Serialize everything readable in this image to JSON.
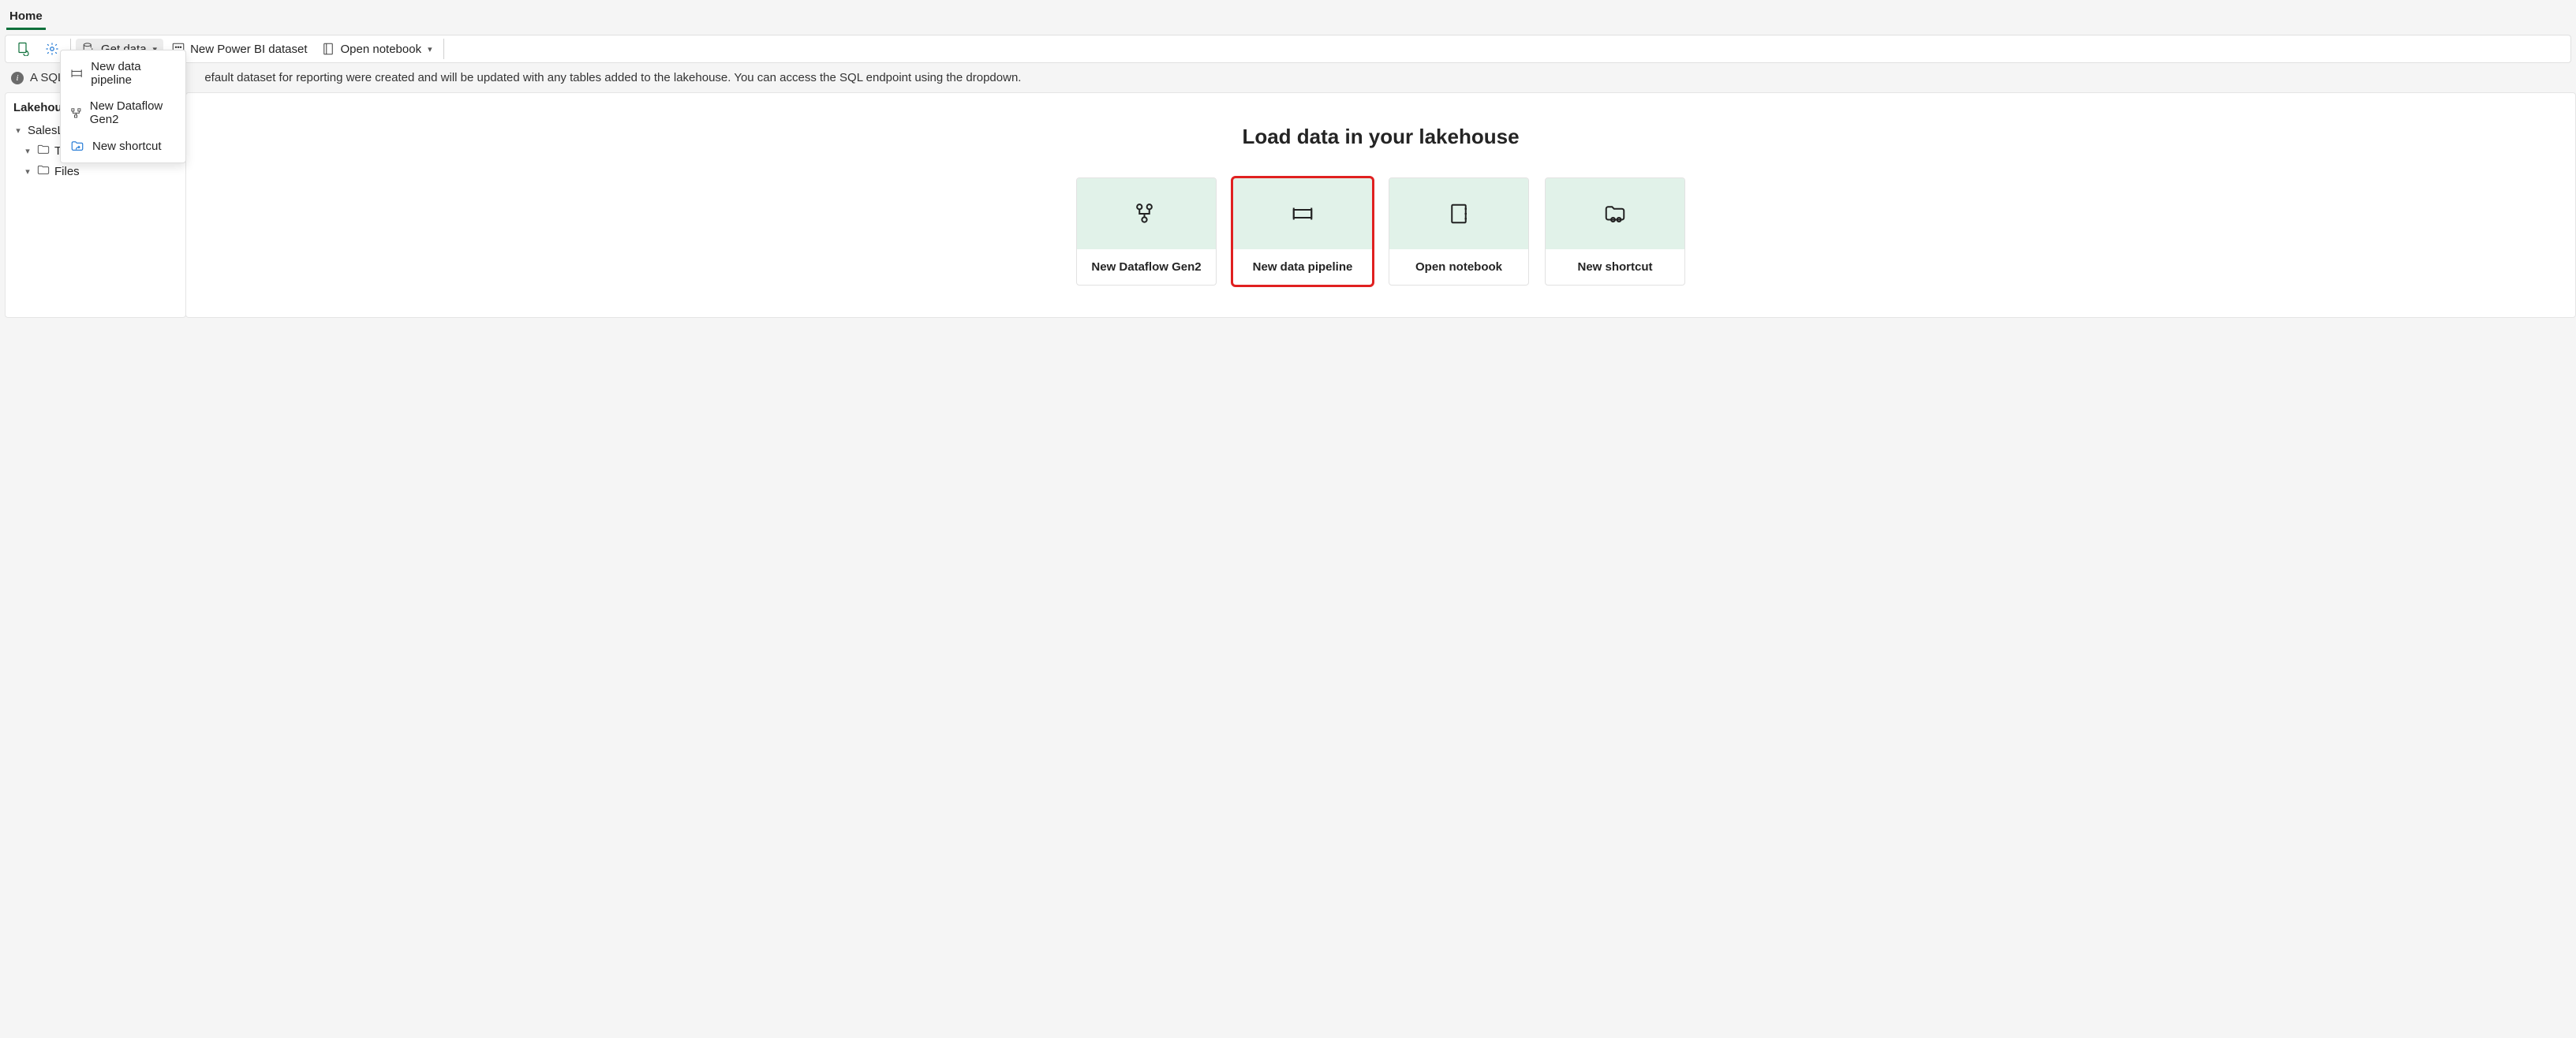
{
  "header": {
    "tab": "Home"
  },
  "toolbar": {
    "get_data": "Get data",
    "new_dataset": "New Power BI dataset",
    "open_notebook": "Open notebook"
  },
  "get_data_menu": {
    "items": [
      {
        "label": "New data pipeline"
      },
      {
        "label": "New Dataflow Gen2"
      },
      {
        "label": "New shortcut"
      }
    ]
  },
  "info": {
    "message_prefix": "A SQL e",
    "message_suffix": "efault dataset for reporting were created and will be updated with any tables added to the lakehouse. You can access the SQL endpoint using the dropdown."
  },
  "tree": {
    "title": "Lakehouse",
    "root": "SalesLakehouse",
    "nodes": [
      {
        "label": "Tables"
      },
      {
        "label": "Files"
      }
    ]
  },
  "main": {
    "heading": "Load data in your lakehouse",
    "cards": [
      {
        "label": "New Dataflow Gen2"
      },
      {
        "label": "New data pipeline"
      },
      {
        "label": "Open notebook"
      },
      {
        "label": "New shortcut"
      }
    ]
  }
}
